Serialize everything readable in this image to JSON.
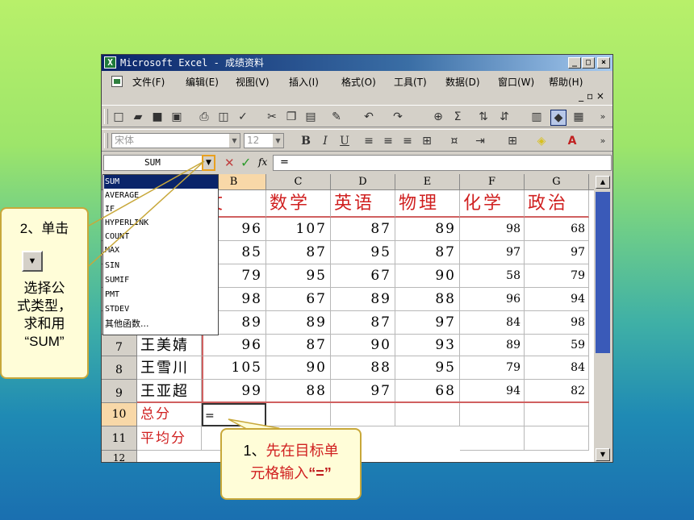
{
  "window": {
    "title": "Microsoft Excel - 成绩资料",
    "min": "_",
    "max": "□",
    "close": "×"
  },
  "menus": [
    "文件(F)",
    "编辑(E)",
    "视图(V)",
    "插入(I)",
    "格式(O)",
    "工具(T)",
    "数据(D)",
    "窗口(W)",
    "帮助(H)"
  ],
  "doc_controls": "_ ▫ ×",
  "toolbar": {
    "font": "宋体",
    "size": "12"
  },
  "formula_bar": {
    "name_box": "SUM",
    "fx": "fx",
    "value": "="
  },
  "columns": [
    "B",
    "C",
    "D",
    "E",
    "F",
    "G"
  ],
  "headers": [
    "语文",
    "数学",
    "英语",
    "物理",
    "化学",
    "政治"
  ],
  "header_b_visible": "文",
  "rows": [
    {
      "num": "",
      "name": "",
      "v": [
        "96",
        "107",
        "87",
        "89",
        "98",
        "68"
      ]
    },
    {
      "num": "",
      "name": "",
      "v": [
        "85",
        "87",
        "95",
        "87",
        "97",
        "97"
      ]
    },
    {
      "num": "",
      "name": "",
      "v": [
        "79",
        "95",
        "67",
        "90",
        "58",
        "79"
      ]
    },
    {
      "num": "",
      "name": "",
      "v": [
        "98",
        "67",
        "89",
        "88",
        "96",
        "94"
      ]
    },
    {
      "num": "",
      "name": "",
      "v": [
        "89",
        "89",
        "87",
        "97",
        "84",
        "98"
      ]
    },
    {
      "num": "7",
      "name": "王美婧",
      "v": [
        "96",
        "87",
        "90",
        "93",
        "89",
        "59"
      ]
    },
    {
      "num": "8",
      "name": "王雪川",
      "v": [
        "105",
        "90",
        "88",
        "95",
        "79",
        "84"
      ]
    },
    {
      "num": "9",
      "name": "王亚超",
      "v": [
        "99",
        "88",
        "97",
        "68",
        "94",
        "82"
      ]
    }
  ],
  "total_row": {
    "num": "10",
    "label": "总分",
    "value": "="
  },
  "avg_row": {
    "num": "11",
    "label": "平均分"
  },
  "row12": "12",
  "dropdown": [
    "SUM",
    "AVERAGE",
    "IF",
    "HYPERLINK",
    "COUNT",
    "MAX",
    "SIN",
    "SUMIF",
    "PMT",
    "STDEV",
    "其他函数..."
  ],
  "callout1": {
    "title": "2、单击",
    "body": [
      "选择公",
      "式类型，",
      "求和用",
      "“SUM”"
    ]
  },
  "callout2": {
    "prefix": "1、",
    "red1": "先在目标单",
    "red2": "元格输入",
    "quote": "“=”"
  }
}
